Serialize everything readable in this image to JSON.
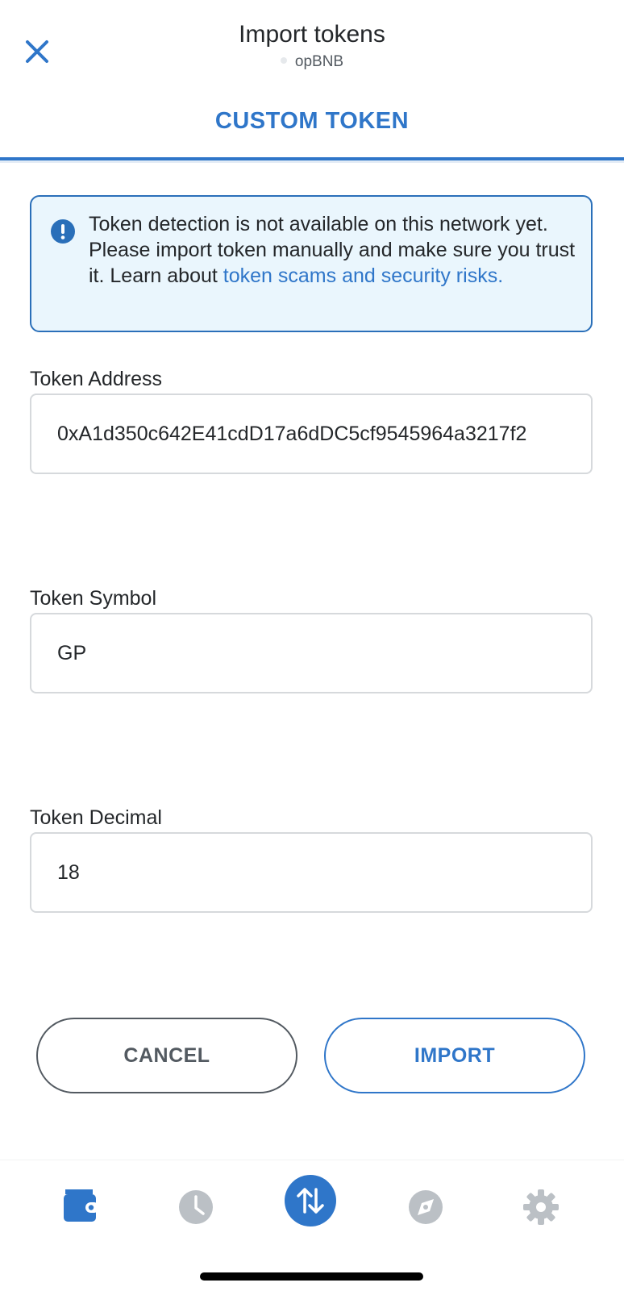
{
  "header": {
    "title": "Import tokens",
    "network": "opBNB"
  },
  "tabs": [
    {
      "label": "CUSTOM TOKEN",
      "active": true
    }
  ],
  "banner": {
    "message": "Token detection is not available on this network yet. Please import token manually and make sure you trust it. Learn about ",
    "link": "token scams and security risks."
  },
  "fields": {
    "address": {
      "label": "Token Address",
      "value": "0xA1d350c642E41cdD17a6dDC5cf9545964a3217f2"
    },
    "symbol": {
      "label": "Token Symbol",
      "value": "GP"
    },
    "decimal": {
      "label": "Token Decimal",
      "value": "18"
    }
  },
  "buttons": {
    "cancel": "CANCEL",
    "import": "IMPORT"
  },
  "tabbar": [
    {
      "icon": "wallet-icon",
      "active": true
    },
    {
      "icon": "clock-icon",
      "active": false
    },
    {
      "icon": "swap-icon",
      "active": false
    },
    {
      "icon": "compass-icon",
      "active": false
    },
    {
      "icon": "gear-icon",
      "active": false
    }
  ],
  "colors": {
    "primary": "#2f76c9",
    "text": "#24272a",
    "muted": "#535a61",
    "border": "#d6d9dc",
    "banner_bg": "#eaf6fd",
    "icon_inactive": "#bbc0c5"
  }
}
